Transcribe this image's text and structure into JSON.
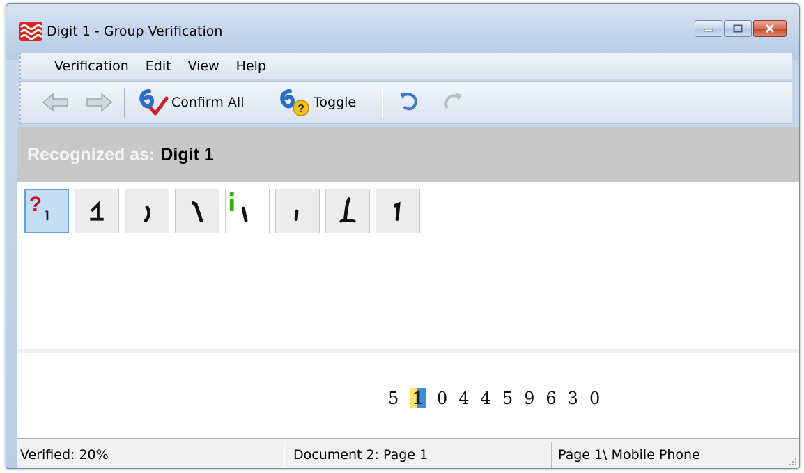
{
  "window": {
    "title": "Digit 1 - Group Verification",
    "icon": "stacked-waves-app-icon",
    "controls": [
      "minimize-icon",
      "maximize-icon",
      "close-icon"
    ]
  },
  "menu": {
    "items": [
      "Verification",
      "Edit",
      "View",
      "Help"
    ]
  },
  "toolbar": {
    "back_icon": "arrow-left-icon",
    "forward_icon": "arrow-right-icon",
    "confirm_all_label": "Confirm All",
    "toggle_label": "Toggle",
    "undo_icon": "undo-icon",
    "redo_icon": "redo-icon"
  },
  "recognized": {
    "prefix": "Recognized as:",
    "value": "Digit 1"
  },
  "thumbnails": {
    "count": 8,
    "selected_index": 0,
    "markers": {
      "0": "question-mark",
      "4": "green-i-mark"
    }
  },
  "source_line": {
    "digits": [
      "5",
      "1",
      "0",
      "4",
      "4",
      "5",
      "9",
      "6",
      "3",
      "0"
    ],
    "highlighted_index": 1
  },
  "status": {
    "verified": "Verified: 20%",
    "document": "Document 2: Page 1",
    "location": "Page 1\\ Mobile Phone"
  },
  "colors": {
    "header_band": "#c7c7c7",
    "selected_thumb": "#c6def5",
    "selected_border": "#5fa2dd",
    "question_mark": "#c0121a",
    "green_marker": "#2db400"
  }
}
